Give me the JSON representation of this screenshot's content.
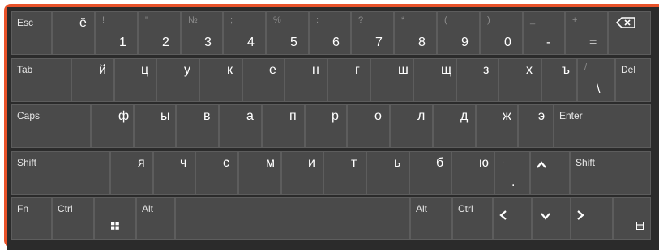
{
  "colors": {
    "frame": "#e8522a",
    "keyboard_bg": "#2b2b2b",
    "key_bg": "#4a4a4a",
    "key_border": "#5d5d5d",
    "text": "#ffffff",
    "dim": "#8d8d8d"
  },
  "rows": [
    [
      {
        "label": "Esc",
        "name": "esc-key"
      },
      {
        "main": "ё",
        "name": "key-yo"
      },
      {
        "shift": "!",
        "main": "1",
        "name": "key-1"
      },
      {
        "shift": "\"",
        "main": "2",
        "name": "key-2"
      },
      {
        "shift": "№",
        "main": "3",
        "name": "key-3"
      },
      {
        "shift": ";",
        "main": "4",
        "name": "key-4"
      },
      {
        "shift": "%",
        "main": "5",
        "name": "key-5"
      },
      {
        "shift": ":",
        "main": "6",
        "name": "key-6"
      },
      {
        "shift": "?",
        "main": "7",
        "name": "key-7"
      },
      {
        "shift": "*",
        "main": "8",
        "name": "key-8"
      },
      {
        "shift": "(",
        "main": "9",
        "name": "key-9"
      },
      {
        "shift": ")",
        "main": "0",
        "name": "key-0"
      },
      {
        "shift": "_",
        "main": "-",
        "name": "key-minus"
      },
      {
        "shift": "+",
        "main": "=",
        "name": "key-equals"
      },
      {
        "icon": "backspace-icon",
        "name": "backspace-key"
      }
    ],
    [
      {
        "label": "Tab",
        "name": "tab-key"
      },
      {
        "main": "й",
        "name": "key-y-short"
      },
      {
        "main": "ц",
        "name": "key-ts"
      },
      {
        "main": "у",
        "name": "key-u"
      },
      {
        "main": "к",
        "name": "key-k"
      },
      {
        "main": "е",
        "name": "key-ye"
      },
      {
        "main": "н",
        "name": "key-n"
      },
      {
        "main": "г",
        "name": "key-g"
      },
      {
        "main": "ш",
        "name": "key-sh"
      },
      {
        "main": "щ",
        "name": "key-shch"
      },
      {
        "main": "з",
        "name": "key-z"
      },
      {
        "main": "х",
        "name": "key-kh"
      },
      {
        "main": "ъ",
        "name": "key-hard-sign"
      },
      {
        "shift": "/",
        "main": "\\",
        "name": "key-backslash"
      },
      {
        "label": "Del",
        "name": "del-key"
      }
    ],
    [
      {
        "label": "Caps",
        "name": "caps-key"
      },
      {
        "main": "ф",
        "name": "key-f"
      },
      {
        "main": "ы",
        "name": "key-y"
      },
      {
        "main": "в",
        "name": "key-v"
      },
      {
        "main": "а",
        "name": "key-a"
      },
      {
        "main": "п",
        "name": "key-p"
      },
      {
        "main": "р",
        "name": "key-r"
      },
      {
        "main": "о",
        "name": "key-o"
      },
      {
        "main": "л",
        "name": "key-l"
      },
      {
        "main": "д",
        "name": "key-d"
      },
      {
        "main": "ж",
        "name": "key-zh"
      },
      {
        "main": "э",
        "name": "key-e"
      },
      {
        "label": "Enter",
        "name": "enter-key"
      }
    ],
    [
      {
        "label": "Shift",
        "name": "shift-left-key"
      },
      {
        "main": "я",
        "name": "key-ya"
      },
      {
        "main": "ч",
        "name": "key-ch"
      },
      {
        "main": "с",
        "name": "key-s"
      },
      {
        "main": "м",
        "name": "key-m"
      },
      {
        "main": "и",
        "name": "key-i"
      },
      {
        "main": "т",
        "name": "key-t"
      },
      {
        "main": "ь",
        "name": "key-soft-sign"
      },
      {
        "main": "б",
        "name": "key-b"
      },
      {
        "main": "ю",
        "name": "key-yu"
      },
      {
        "shift": ",",
        "main": ".",
        "name": "key-period"
      },
      {
        "icon": "arrow-up-icon",
        "name": "arrow-up-key"
      },
      {
        "label": "Shift",
        "name": "shift-right-key"
      }
    ],
    [
      {
        "label": "Fn",
        "name": "fn-key"
      },
      {
        "label": "Ctrl",
        "name": "ctrl-left-key"
      },
      {
        "icon": "windows-icon",
        "name": "windows-key"
      },
      {
        "label": "Alt",
        "name": "alt-left-key"
      },
      {
        "label": "",
        "name": "space-key"
      },
      {
        "label": "Alt",
        "name": "alt-right-key"
      },
      {
        "label": "Ctrl",
        "name": "ctrl-right-key"
      },
      {
        "icon": "arrow-left-icon",
        "name": "arrow-left-key"
      },
      {
        "icon": "arrow-down-icon",
        "name": "arrow-down-key"
      },
      {
        "icon": "arrow-right-icon",
        "name": "arrow-right-key"
      },
      {
        "icon": "keyboard-icon",
        "name": "keyboard-key"
      }
    ]
  ]
}
